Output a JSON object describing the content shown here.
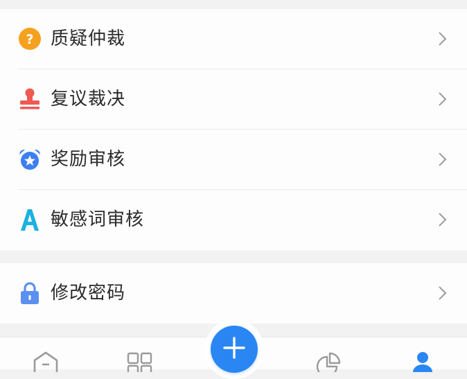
{
  "menu": {
    "items": [
      {
        "label": "质疑仲裁",
        "icon": "question-circle-icon"
      },
      {
        "label": "复议裁决",
        "icon": "stamp-icon"
      },
      {
        "label": "奖励审核",
        "icon": "alarm-clock-icon"
      },
      {
        "label": "敏感词审核",
        "icon": "letter-a-icon"
      }
    ]
  },
  "account": {
    "items": [
      {
        "label": "修改密码",
        "icon": "lock-icon"
      }
    ]
  },
  "tabbar": {
    "tabs": [
      {
        "icon": "home-icon"
      },
      {
        "icon": "grid-icon"
      },
      {
        "icon": "add-icon"
      },
      {
        "icon": "pie-chart-icon"
      },
      {
        "icon": "user-icon"
      }
    ]
  },
  "colors": {
    "question": "#f5a11f",
    "stamp": "#ee5a52",
    "alarm": "#3d7ff0",
    "letter_a": "#1bb2e0",
    "lock": "#5b8ff0",
    "accent": "#2a86f3",
    "chevron": "#999999",
    "tab_inactive": "#9a9a9a",
    "tab_active": "#2a86f3"
  }
}
